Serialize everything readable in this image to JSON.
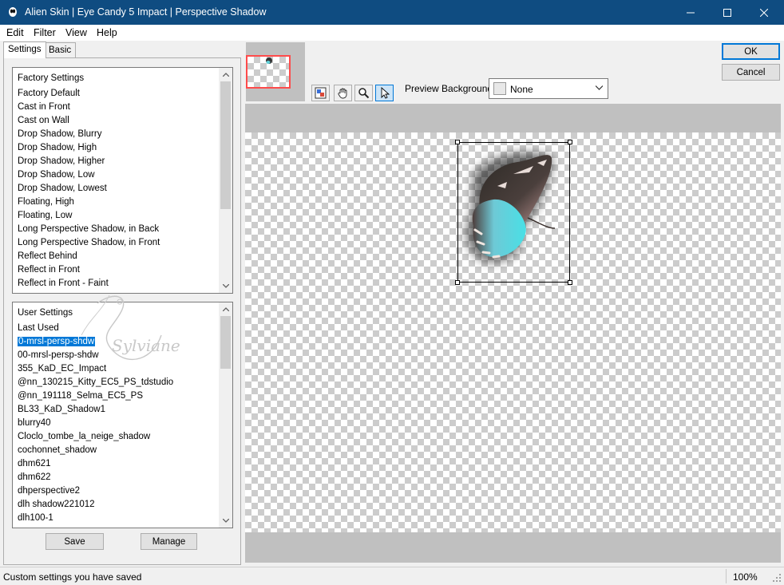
{
  "window": {
    "title": "Alien Skin | Eye Candy 5 Impact | Perspective Shadow",
    "minimize_icon": "minimize-icon",
    "maximize_icon": "maximize-icon",
    "close_icon": "close-icon"
  },
  "menu": [
    "Edit",
    "Filter",
    "View",
    "Help"
  ],
  "tabs": {
    "settings": "Settings",
    "basic": "Basic"
  },
  "factory_settings": {
    "header": "Factory Settings",
    "items": [
      "Factory Default",
      "Cast in Front",
      "Cast on Wall",
      "Drop Shadow, Blurry",
      "Drop Shadow, High",
      "Drop Shadow, Higher",
      "Drop Shadow, Low",
      "Drop Shadow, Lowest",
      "Floating, High",
      "Floating, Low",
      "Long Perspective Shadow, in Back",
      "Long Perspective Shadow, in Front",
      "Reflect Behind",
      "Reflect in Front",
      "Reflect in Front - Faint"
    ]
  },
  "user_settings": {
    "header": "User Settings",
    "selected": "0-mrsl-persp-shdw",
    "items": [
      "Last Used",
      "0-mrsl-persp-shdw",
      "00-mrsl-persp-shdw",
      "355_KaD_EC_Impact",
      "@nn_130215_Kitty_EC5_PS_tdstudio",
      "@nn_191118_Selma_EC5_PS",
      "BL33_KaD_Shadow1",
      "blurry40",
      "Cloclo_tombe_la_neige_shadow",
      "cochonnet_shadow",
      "dhm621",
      "dhm622",
      "dhperspective2",
      "dlh shadow221012",
      "dlh100-1"
    ]
  },
  "buttons": {
    "save": "Save",
    "manage": "Manage",
    "ok": "OK",
    "cancel": "Cancel"
  },
  "preview": {
    "background_label": "Preview Background:",
    "background_value": "None"
  },
  "tools": [
    "preview-toggle-icon",
    "hand-icon",
    "zoom-icon",
    "arrow-icon"
  ],
  "status": {
    "text": "Custom settings you have saved",
    "zoom": "100%"
  },
  "watermark": "Sylviane",
  "colors": {
    "titlebar": "#0f4c81",
    "selection": "#0078d7"
  }
}
